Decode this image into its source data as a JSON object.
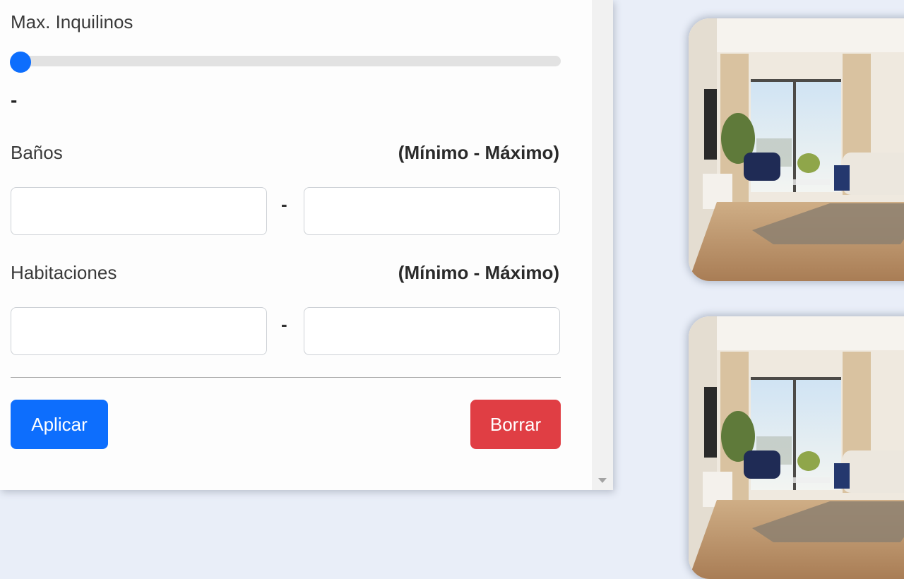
{
  "filters": {
    "max_tenants": {
      "label": "Max. Inquilinos",
      "slider_fraction": 0,
      "value_display": "-"
    },
    "bathrooms": {
      "label": "Baños",
      "range_hint": "(Mínimo - Máximo)",
      "min_value": "",
      "max_value": "",
      "separator": "-"
    },
    "rooms": {
      "label": "Habitaciones",
      "range_hint": "(Mínimo - Máximo)",
      "min_value": "",
      "max_value": "",
      "separator": "-"
    },
    "apply_label": "Aplicar",
    "clear_label": "Borrar"
  },
  "colors": {
    "primary": "#0d6efd",
    "danger": "#e03e44"
  },
  "listings": [
    {
      "image": "living-room-photo"
    },
    {
      "image": "living-room-photo"
    }
  ]
}
